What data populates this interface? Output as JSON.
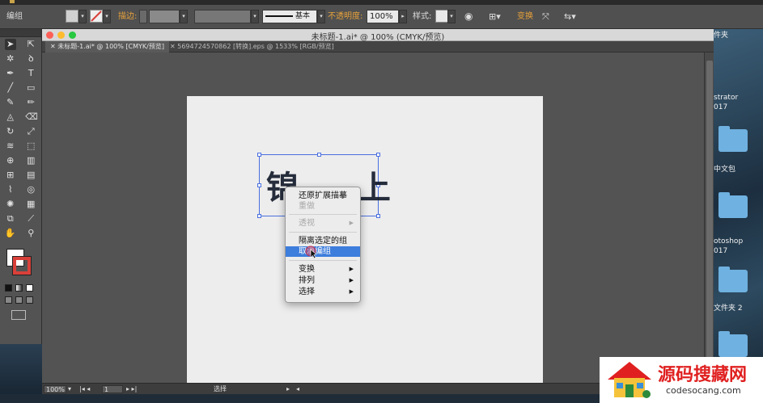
{
  "controlbar": {
    "selection_label": "编组",
    "stroke_label": "描边:",
    "stroke_style": "基本",
    "opacity_label": "不透明度:",
    "opacity_value": "100%",
    "style_label": "样式:",
    "transform_label": "变换"
  },
  "window": {
    "title": "未标题-1.ai* @ 100% (CMYK/预览)",
    "tabs": [
      {
        "label": "未标题-1.ai* @ 100% [CMYK/预览]",
        "active": true
      },
      {
        "label": "5694724570862 [转换].eps @ 1533% [RGB/预览]",
        "active": false
      }
    ]
  },
  "artwork": {
    "text": "锦 上"
  },
  "context_menu": {
    "items": [
      {
        "label": "还原扩展描摹",
        "disabled": false,
        "submenu": false
      },
      {
        "label": "重做",
        "disabled": true,
        "submenu": false
      },
      {
        "label": "透视",
        "disabled": true,
        "submenu": true
      },
      {
        "label": "隔离选定的组",
        "disabled": false,
        "submenu": false
      },
      {
        "label": "取消编组",
        "disabled": false,
        "submenu": false,
        "highlighted": true
      },
      {
        "label": "变换",
        "disabled": false,
        "submenu": true
      },
      {
        "label": "排列",
        "disabled": false,
        "submenu": true
      },
      {
        "label": "选择",
        "disabled": false,
        "submenu": true
      }
    ]
  },
  "statusbar": {
    "zoom": "100%",
    "artboard": "1",
    "tool": "选择"
  },
  "desktop": {
    "labels": [
      "件夹",
      "strator",
      "017",
      "中文包",
      "otoshop",
      "017",
      "文件夹 2"
    ]
  },
  "watermark": {
    "title": "源码搜藏网",
    "url": "codesocang.com"
  },
  "colors": {
    "accent": "#3d7ddc",
    "selection": "#4a6fe0",
    "orange_label": "#e8a23a",
    "watermark_red": "#e02020"
  }
}
